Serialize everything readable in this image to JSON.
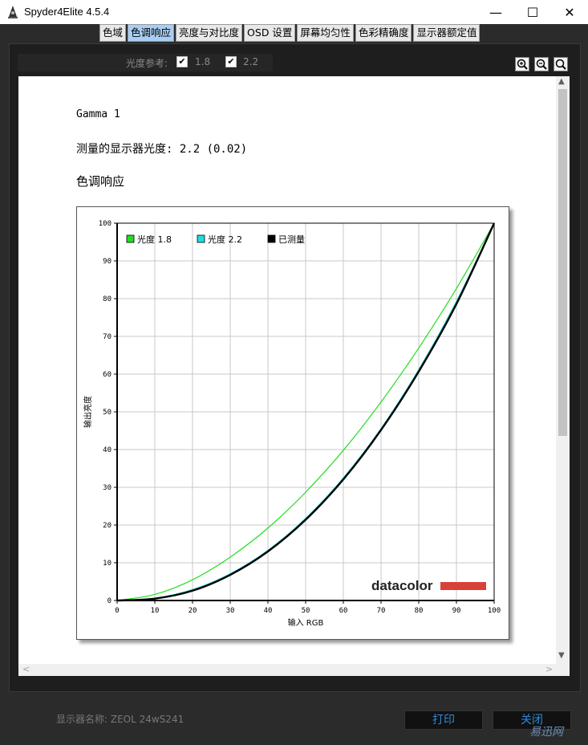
{
  "window": {
    "title": "Spyder4Elite 4.5.4",
    "minimize": "—",
    "maximize": "☐",
    "close": "✕"
  },
  "tabs": [
    {
      "label": "色域",
      "active": false
    },
    {
      "label": "色调响应",
      "active": true
    },
    {
      "label": "亮度与对比度",
      "active": false
    },
    {
      "label": "OSD 设置",
      "active": false
    },
    {
      "label": "屏幕均匀性",
      "active": false
    },
    {
      "label": "色彩精确度",
      "active": false
    },
    {
      "label": "显示器额定值",
      "active": false
    }
  ],
  "toolbar": {
    "gamma_ref_label": "光度参考:",
    "opt1_label": "1.8",
    "opt1_checked": true,
    "opt2_label": "2.2",
    "opt2_checked": true,
    "check_mark": "✔"
  },
  "report": {
    "heading": "Gamma 1",
    "measured": "测量的显示器光度:  2.2 (0.02)",
    "section": "色调响应"
  },
  "chart_data": {
    "type": "line",
    "title": "",
    "xlabel": "输入 RGB",
    "ylabel": "输出亮度",
    "xlim": [
      0,
      100
    ],
    "ylim": [
      0,
      100
    ],
    "xticks": [
      0,
      10,
      20,
      30,
      40,
      50,
      60,
      70,
      80,
      90,
      100
    ],
    "yticks": [
      0,
      10,
      20,
      30,
      40,
      50,
      60,
      70,
      80,
      90,
      100
    ],
    "grid": true,
    "legend_position": "top-left",
    "series": [
      {
        "name": "光度 1.8",
        "color": "#22dd22",
        "x": [
          0,
          10,
          20,
          30,
          40,
          50,
          60,
          70,
          80,
          90,
          100
        ],
        "y": [
          0,
          1.6,
          5.5,
          11.5,
          19.2,
          28.7,
          39.8,
          52.6,
          66.9,
          82.7,
          100
        ]
      },
      {
        "name": "光度 2.2",
        "color": "#22dddd",
        "x": [
          0,
          10,
          20,
          30,
          40,
          50,
          60,
          70,
          80,
          90,
          100
        ],
        "y": [
          0,
          0.6,
          2.9,
          7.1,
          13.3,
          21.8,
          32.5,
          45.6,
          61.2,
          79.3,
          100
        ]
      },
      {
        "name": "已测量",
        "color": "#000000",
        "x": [
          0,
          10,
          20,
          30,
          40,
          50,
          60,
          70,
          80,
          90,
          100
        ],
        "y": [
          0,
          0.5,
          2.6,
          6.8,
          13.0,
          21.4,
          32.1,
          45.2,
          60.7,
          78.6,
          100
        ]
      }
    ],
    "logo_text": "datacolor"
  },
  "footer": {
    "display_name": "显示器名称: ZEOL 24wS241",
    "print_label": "打印",
    "close_label": "关闭",
    "watermark": "易迅网"
  }
}
